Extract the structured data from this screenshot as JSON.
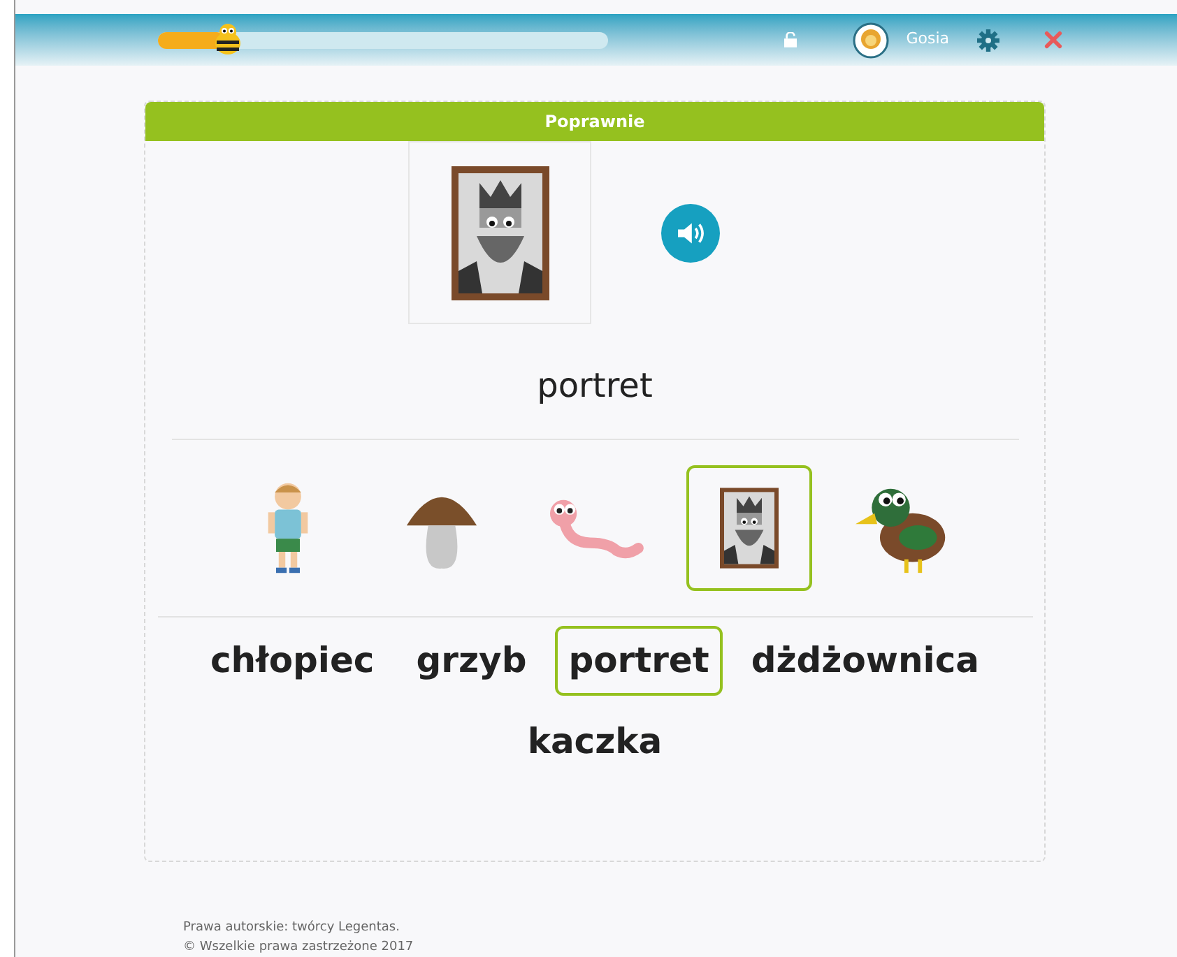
{
  "header": {
    "progress": {
      "level": 0.15
    },
    "user": {
      "name": "Gosia"
    }
  },
  "exercise": {
    "status": "Poprawnie",
    "prompt_word": "portret",
    "pictures": [
      {
        "kind": "boy",
        "selected": false
      },
      {
        "kind": "mushroom",
        "selected": false
      },
      {
        "kind": "worm",
        "selected": false
      },
      {
        "kind": "portrait",
        "selected": true
      },
      {
        "kind": "duck",
        "selected": false
      }
    ],
    "words": [
      {
        "label": "chłopiec",
        "selected": false
      },
      {
        "label": "grzyb",
        "selected": false
      },
      {
        "label": "portret",
        "selected": true
      },
      {
        "label": "dżdżownica",
        "selected": false
      },
      {
        "label": "kaczka",
        "selected": false
      }
    ]
  },
  "footer": {
    "lines": [
      "Prawa autorskie: twórcy Legentas.",
      "© Wszelkie prawa zastrzeżone 2017"
    ]
  }
}
